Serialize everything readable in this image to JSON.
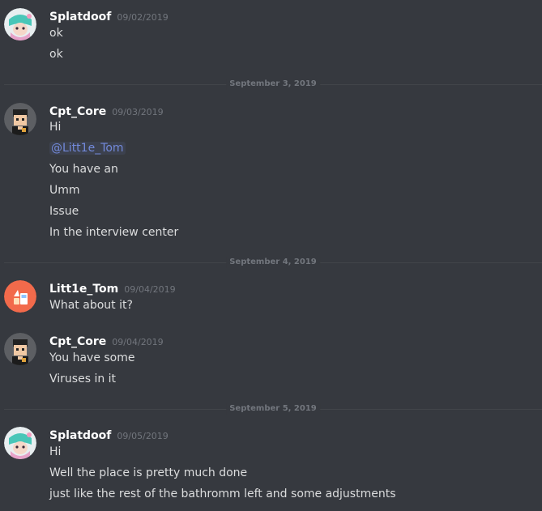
{
  "colors": {
    "background": "#36393f",
    "username": "#ffffff",
    "timestamp": "#72767d",
    "message_text": "#dcddde",
    "mention": "#7289da",
    "divider": "#42454a"
  },
  "groups": [
    {
      "author": "Splatdoof",
      "timestamp": "09/02/2019",
      "avatar_icon": "splatdoof-avatar-icon",
      "messages": [
        "ok",
        "ok"
      ]
    },
    {
      "author": "Cpt_Core",
      "timestamp": "09/03/2019",
      "avatar_icon": "cpt-core-avatar-icon",
      "messages": [
        "Hi",
        "@Litt1e_Tom",
        "You have an",
        "Umm",
        "Issue",
        "In the interview center"
      ]
    },
    {
      "author": "Litt1e_Tom",
      "timestamp": "09/04/2019",
      "avatar_icon": "litt1e-tom-avatar-icon",
      "messages": [
        "What about it?"
      ]
    },
    {
      "author": "Cpt_Core",
      "timestamp": "09/04/2019",
      "avatar_icon": "cpt-core-avatar-icon",
      "messages": [
        "You have some",
        "Viruses in it"
      ]
    },
    {
      "author": "Splatdoof",
      "timestamp": "09/05/2019",
      "avatar_icon": "splatdoof-avatar-icon",
      "messages": [
        "Hi",
        "Well the place is pretty much done",
        "just like the rest of the bathromm left and some adjustments"
      ]
    }
  ],
  "dividers": [
    "September 3, 2019",
    "September 4, 2019",
    "September 5, 2019"
  ]
}
